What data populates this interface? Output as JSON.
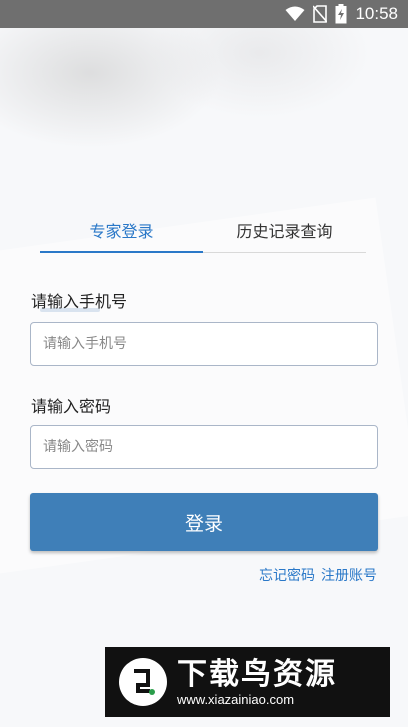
{
  "status_bar": {
    "time": "10:58",
    "icons": [
      "wifi-icon",
      "no-sim-icon",
      "battery-charging-icon"
    ]
  },
  "tabs": [
    {
      "label": "专家登录",
      "active": true
    },
    {
      "label": "历史记录查询",
      "active": false
    }
  ],
  "form": {
    "phone_label": "请输入手机号",
    "phone_placeholder": "请输入手机号",
    "phone_value": "",
    "password_label": "请输入密码",
    "password_placeholder": "请输入密码",
    "password_value": "",
    "login_label": "登录",
    "forgot_label": "忘记密码",
    "register_label": "注册账号"
  },
  "watermark": {
    "title": "下载鸟资源",
    "url": "www.xiazainiao.com"
  },
  "colors": {
    "accent": "#2a78c8",
    "button": "#3f7fb8",
    "status_bar": "#6f6f6f"
  }
}
